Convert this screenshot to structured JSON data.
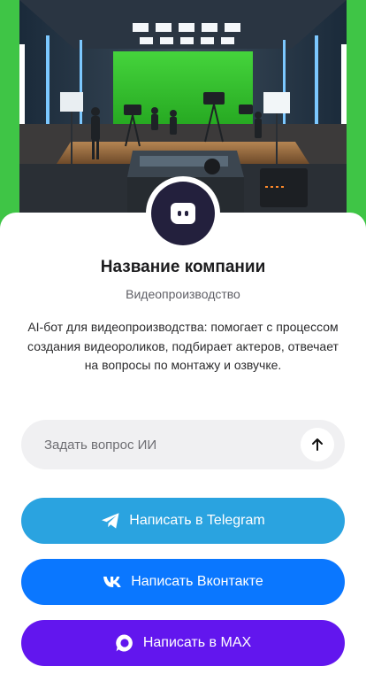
{
  "hero": {
    "image": "video-studio-photo",
    "bg_color": "#2d9b36"
  },
  "profile": {
    "avatar_icon": "chat-bot-icon",
    "avatar_color": "#23203d",
    "company_name": "Название компании",
    "category": "Видеопроизводство",
    "description": "AI-бот для видеопроизводства: помогает с процессом создания видеороликов, подбирает актеров, отвечает на вопросы по монтажу и озвучке."
  },
  "ask": {
    "placeholder": "Задать вопрос ИИ",
    "value": "",
    "send_icon": "arrow-up-icon"
  },
  "buttons": {
    "telegram": {
      "label": "Написать в Telegram",
      "icon": "telegram-icon",
      "color": "#2aa3e0"
    },
    "vk": {
      "label": "Написать Вконтакте",
      "icon": "vk-icon",
      "color": "#0a77ff"
    },
    "max": {
      "label": "Написать в MAX",
      "icon": "max-icon",
      "color": "#6216ee"
    }
  }
}
